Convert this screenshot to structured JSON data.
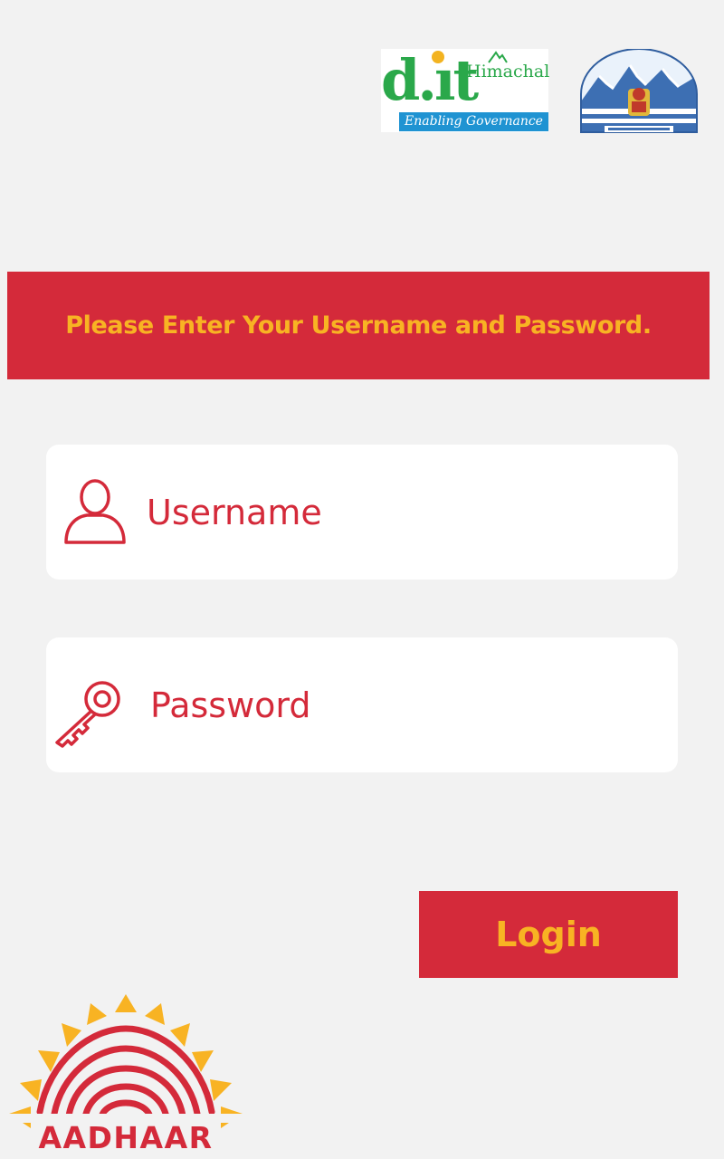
{
  "header": {
    "dit_logo": {
      "letters": "d.it",
      "region": "Himachal",
      "tagline": "Enabling Governance"
    },
    "state_emblem_icon": "himachal-pradesh-emblem"
  },
  "banner": {
    "message": "Please Enter Your Username and Password."
  },
  "form": {
    "username": {
      "placeholder": "Username",
      "value": "",
      "icon": "user-icon"
    },
    "password": {
      "placeholder": "Password",
      "value": "",
      "icon": "key-icon"
    },
    "login_label": "Login"
  },
  "footer": {
    "aadhaar_label": "AADHAAR",
    "aadhaar_icon": "aadhaar-sun-fingerprint-logo"
  },
  "colors": {
    "background": "#f2f2f2",
    "brand_red": "#d42a3a",
    "brand_yellow": "#f8b323",
    "dit_green": "#2aa84a",
    "dit_blue": "#1f93d2"
  }
}
